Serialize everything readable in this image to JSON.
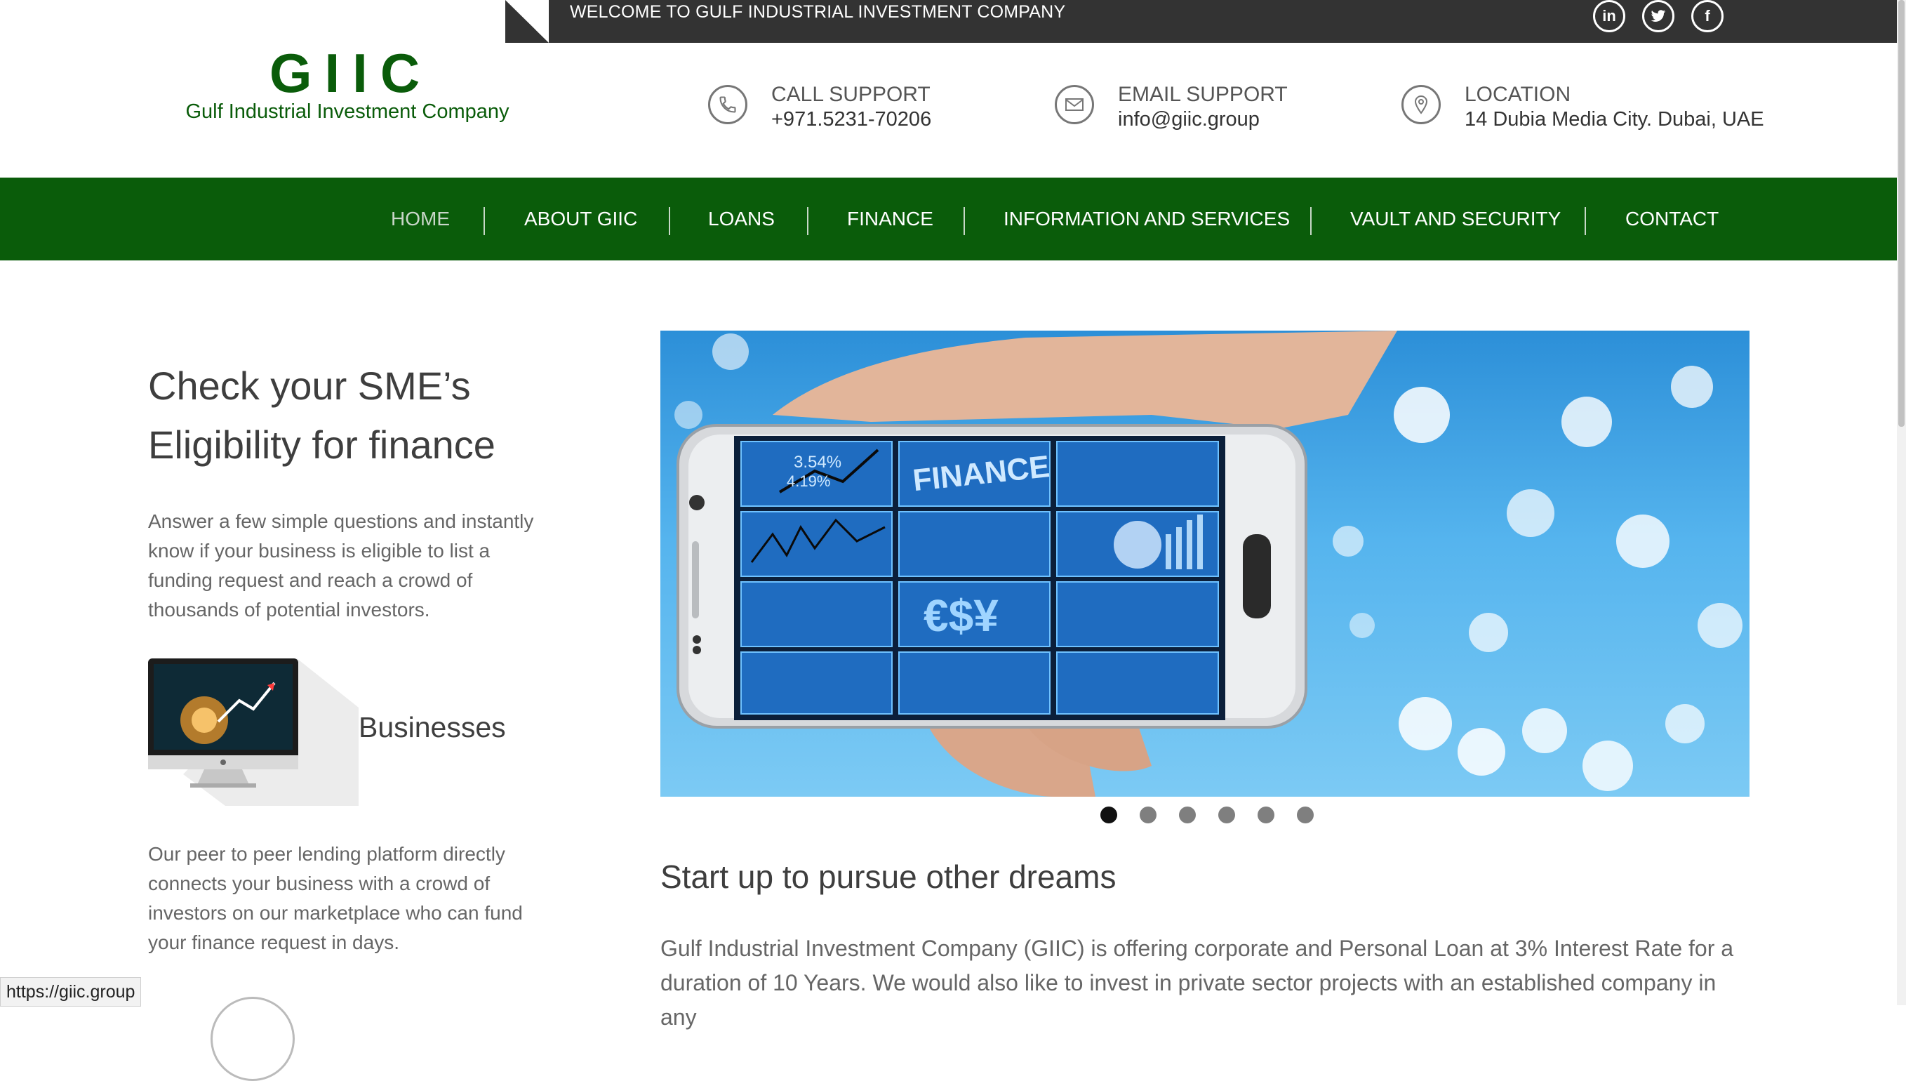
{
  "topbar": {
    "welcome": "WELCOME TO GULF INDUSTRIAL INVESTMENT COMPANY",
    "social": [
      {
        "name": "linkedin-icon",
        "glyph": "in"
      },
      {
        "name": "twitter-icon",
        "glyph": "t"
      },
      {
        "name": "facebook-icon",
        "glyph": "f"
      }
    ]
  },
  "logo": {
    "mark": "GIIC",
    "subtitle": "Gulf Industrial Investment Company"
  },
  "contacts": {
    "call": {
      "title": "CALL SUPPORT",
      "value": "+971.5231-70206",
      "icon": "phone-icon"
    },
    "email": {
      "title": "EMAIL SUPPORT",
      "value": "info@giic.group",
      "icon": "envelope-icon"
    },
    "location": {
      "title": "LOCATION",
      "value": "14 Dubia Media City. Dubai, UAE",
      "icon": "map-pin-icon"
    }
  },
  "nav": {
    "items": [
      "HOME",
      "ABOUT GIIC",
      "LOANS",
      "FINANCE",
      "INFORMATION AND SERVICES",
      "VAULT AND SECURITY",
      "CONTACT"
    ],
    "active": "HOME"
  },
  "left": {
    "headline_line1": "Check your SME’s",
    "headline_line2": "Eligibility for finance",
    "intro": "Answer a few simple questions and instantly know if your business is eligible to list a funding request and reach a crowd of thousands of potential investors.",
    "business_label": "Businesses",
    "business_text": "Our peer to peer lending platform directly connects your business with a crowd of investors on our marketplace who can fund your finance request in days."
  },
  "slider": {
    "slide_count": 6,
    "active_index": 0,
    "screen_texts": [
      "3.54%",
      "4.19%",
      "FINANCE",
      "€$¥"
    ],
    "title": "Start up to pursue other dreams",
    "text": "Gulf Industrial Investment Company (GIIC) is offering corporate and Personal Loan at 3% Interest Rate for a duration of 10 Years. We would also like to invest in private sector projects with an established company in any"
  },
  "status": {
    "url": "https://giic.group"
  },
  "colors": {
    "brand_green": "#0a5c0a",
    "topbar_dark": "#333333",
    "sky_blue": "#55b4ee"
  }
}
